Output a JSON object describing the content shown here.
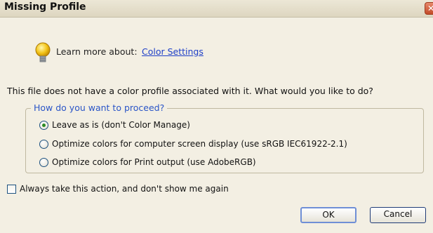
{
  "dialog": {
    "title": "Missing Profile",
    "close_glyph": "✕"
  },
  "learn": {
    "prefix": "Learn more about:",
    "link": "Color Settings",
    "icon": "lightbulb-icon"
  },
  "question": "This file does not have a color profile associated with it. What would you like to do?",
  "proceed": {
    "legend": "How do you want to proceed?",
    "options": [
      {
        "label": "Leave as is (don't Color Manage)",
        "checked": true
      },
      {
        "label": "Optimize colors for computer screen display (use sRGB IEC61922-2.1)",
        "checked": false
      },
      {
        "label": "Optimize colors for Print output (use AdobeRGB)",
        "checked": false
      }
    ]
  },
  "always_checkbox": {
    "label": "Always take this action, and don't show me again",
    "checked": false
  },
  "buttons": {
    "ok": "OK",
    "cancel": "Cancel"
  },
  "colors": {
    "accent": "#2a55c7",
    "link": "#1e3fc8",
    "background": "#f3efe3"
  }
}
